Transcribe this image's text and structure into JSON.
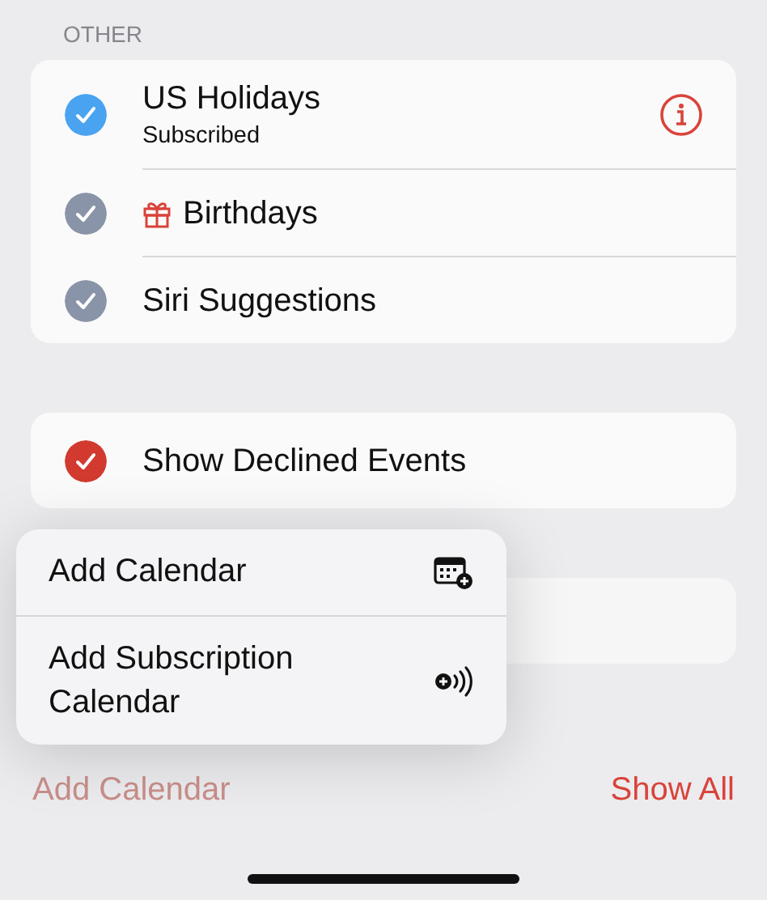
{
  "section_header": "OTHER",
  "calendars": [
    {
      "name": "US Holidays",
      "subtitle": "Subscribed",
      "checked": true,
      "color": "#4aa3f0",
      "kind": "plain",
      "info_button": true
    },
    {
      "name": "Birthdays",
      "checked": true,
      "color": "#8a94a8",
      "kind": "birthday",
      "info_button": false
    },
    {
      "name": "Siri Suggestions",
      "checked": true,
      "color": "#8a94a8",
      "kind": "plain",
      "info_button": false
    }
  ],
  "declined_events": {
    "label": "Show Declined Events",
    "checked": true,
    "color": "#d23a30"
  },
  "menu": [
    {
      "label": "Add Calendar",
      "kind": "calendar"
    },
    {
      "label": "Add Subscription Calendar",
      "kind": "subscription"
    }
  ],
  "footer": {
    "add_calendar": {
      "label": "Add Calendar",
      "disabled": true
    },
    "show_all": {
      "label": "Show All",
      "disabled": false
    }
  }
}
